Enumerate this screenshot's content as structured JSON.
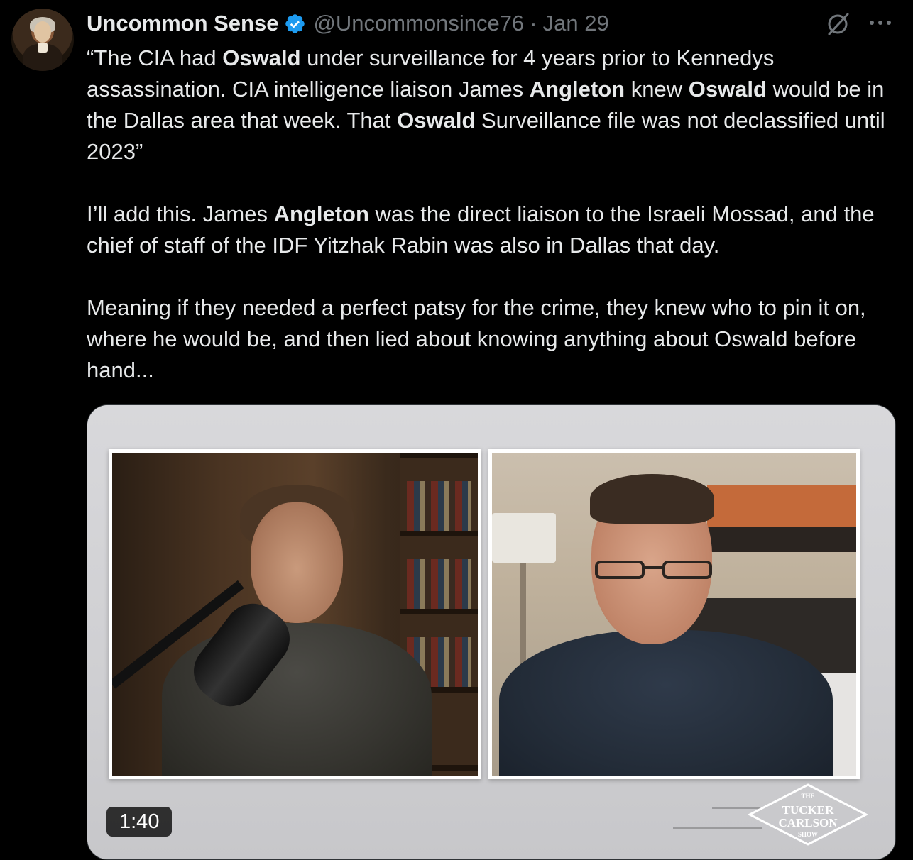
{
  "author": {
    "name": "Uncommon Sense",
    "handle": "@Uncommonsince76",
    "separator": "·",
    "date": "Jan 29",
    "verified": true,
    "avatar_icon": "avatar"
  },
  "actions": {
    "grok_icon": "grok-icon",
    "more_icon": "more-icon"
  },
  "tweet": {
    "p1": [
      {
        "t": "“The CIA had ",
        "b": false
      },
      {
        "t": "Oswald",
        "b": true
      },
      {
        "t": " under surveillance for 4 years prior to Kennedys assassination. CIA intelligence liaison James ",
        "b": false
      },
      {
        "t": "Angleton",
        "b": true
      },
      {
        "t": " knew ",
        "b": false
      },
      {
        "t": "Oswald",
        "b": true
      },
      {
        "t": " would be in the Dallas area that week. That ",
        "b": false
      },
      {
        "t": "Oswald",
        "b": true
      },
      {
        "t": " Surveillance file was not declassified until 2023”",
        "b": false
      }
    ],
    "p2": [
      {
        "t": "I’ll add this. James ",
        "b": false
      },
      {
        "t": "Angleton",
        "b": true
      },
      {
        "t": " was the direct liaison to the Israeli Mossad, and the chief of staff of the IDF Yitzhak Rabin was also in Dallas that day.",
        "b": false
      }
    ],
    "p3": [
      {
        "t": "Meaning if they needed a perfect patsy for the crime, they knew who to pin it on, where he would be, and then lied about knowing anything about Oswald before hand...",
        "b": false
      }
    ]
  },
  "media": {
    "duration": "1:40",
    "logo": {
      "top": "THE",
      "line1": "TUCKER",
      "line2": "CARLSON",
      "bottom": "SHOW"
    }
  },
  "colors": {
    "background": "#000000",
    "text": "#e7e9ea",
    "secondary": "#71767b",
    "verified": "#1d9bf0"
  }
}
